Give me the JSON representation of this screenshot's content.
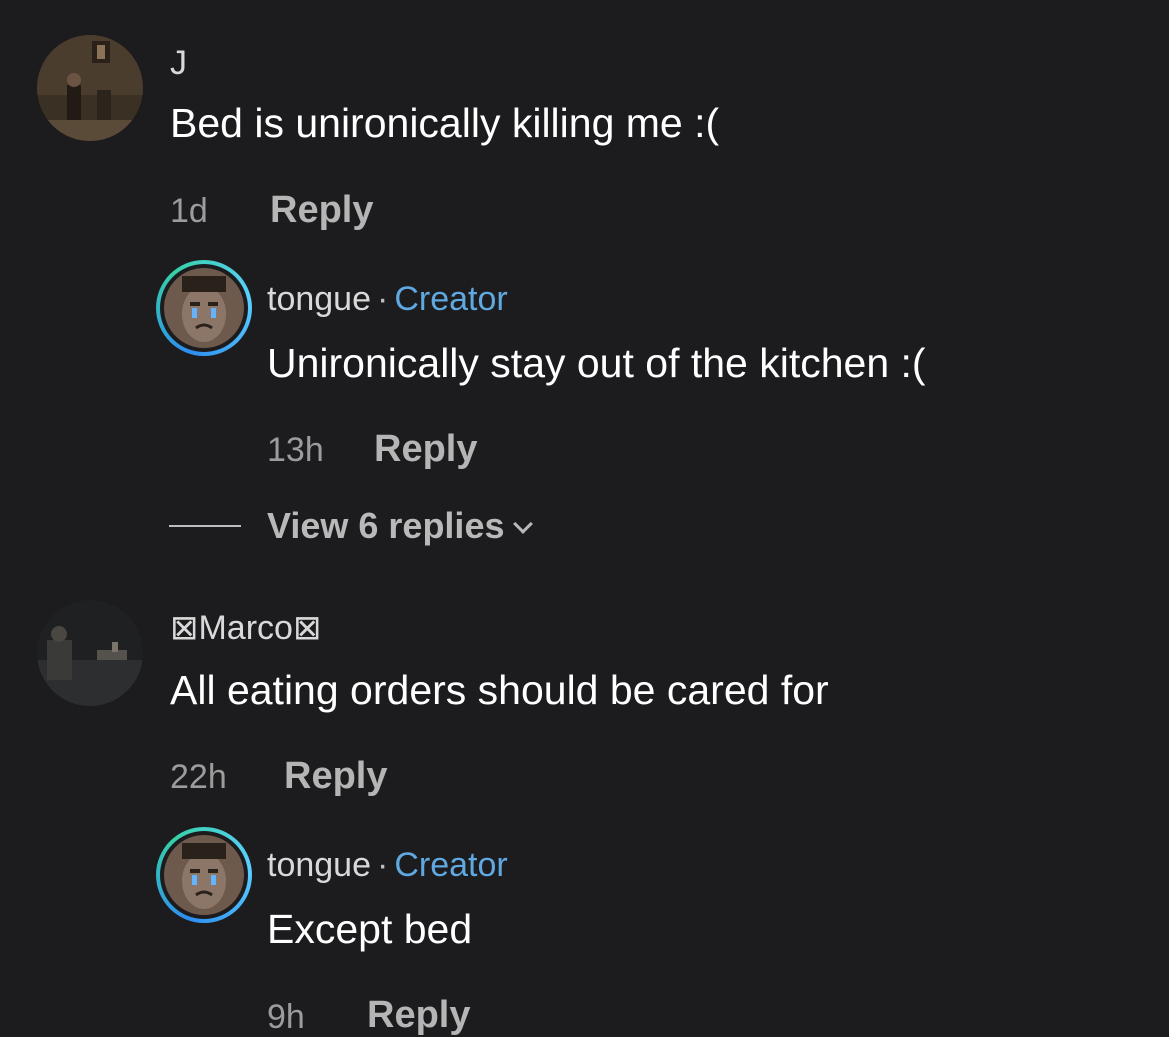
{
  "comments": [
    {
      "username": "J",
      "text": "Bed is unironically killing me :(",
      "time": "1d",
      "reply_label": "Reply",
      "reply": {
        "username": "tongue",
        "dot": "·",
        "badge": "Creator",
        "text": "Unironically stay out of the kitchen :(",
        "time": "13h",
        "reply_label": "Reply"
      },
      "view_replies": "View 6 replies"
    },
    {
      "username": "⊠Marco⊠",
      "text": "All eating orders should be cared for",
      "time": "22h",
      "reply_label": "Reply",
      "reply": {
        "username": "tongue",
        "dot": "·",
        "badge": "Creator",
        "text": "Except bed",
        "time": "9h",
        "reply_label": "Reply"
      }
    }
  ],
  "colors": {
    "background": "#1c1b1e",
    "creator_badge": "#5fa8e0",
    "ring_start": "#2d8df0",
    "ring_end": "#36d1a6"
  }
}
